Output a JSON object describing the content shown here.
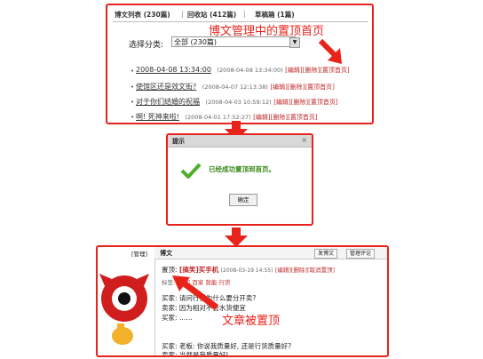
{
  "panel1": {
    "tabs": [
      "博文列表 (230篇)",
      "回收站 (412篇)",
      "草稿箱 (1篇)"
    ],
    "note": "博文管理中的置顶首页",
    "filter_label": "选择分类:",
    "filter_value": "全部 (230篇)",
    "posts": [
      {
        "title": "2008-04-08 13:34:00",
        "date": "(2008-04-08 13:34:00)",
        "edit": "[编辑]",
        "del": "[删除]",
        "top": "[置顶首页]"
      },
      {
        "title": "使馆区还是效文街?",
        "date": "(2008-04-07 12:13:38)",
        "edit": "[编辑]",
        "del": "[删除]",
        "top": "[置顶首页]"
      },
      {
        "title": "对于你们结婚的祝福",
        "date": "(2008-04-03 10:59:12)",
        "edit": "[编辑]",
        "del": "[删除]",
        "top": "[置顶首页]"
      },
      {
        "title": "啊! 死神来啦!",
        "date": "(2008-04-01 17:52:27)",
        "edit": "[编辑]",
        "del": "[删除]",
        "top": "[置顶首页]"
      }
    ]
  },
  "panel2": {
    "title": "提示",
    "close": "×",
    "message": "已经成功置顶到首页。",
    "ok": "确定"
  },
  "panel3": {
    "left_tag": "[管理]",
    "head_label": "博文",
    "btn_post": "发博文",
    "btn_manage": "管理评论",
    "top_prefix": "置顶:",
    "top_title": "[搞笑]买手机",
    "top_date": "(2008-03-19 14:55)",
    "top_edit": "[编辑]",
    "top_del": "[删除]",
    "top_cancel": "[取消置顶]",
    "tags_label": "标签:",
    "tag_links": "买  买  百家  就能  行货",
    "lines": [
      "买家: 请问行货为什么要分开卖?",
      "卖家: 因为相对不会水货便宜",
      "买家: ……"
    ],
    "lines2": [
      "买家: 老板: 你说我质量好, 还是行货质量好?",
      "卖家: 当然是我质量好!"
    ],
    "note": "文章被置顶"
  },
  "colors": {
    "accent": "#e8231b",
    "link": "#c0282a",
    "success": "#3a8a1a"
  }
}
